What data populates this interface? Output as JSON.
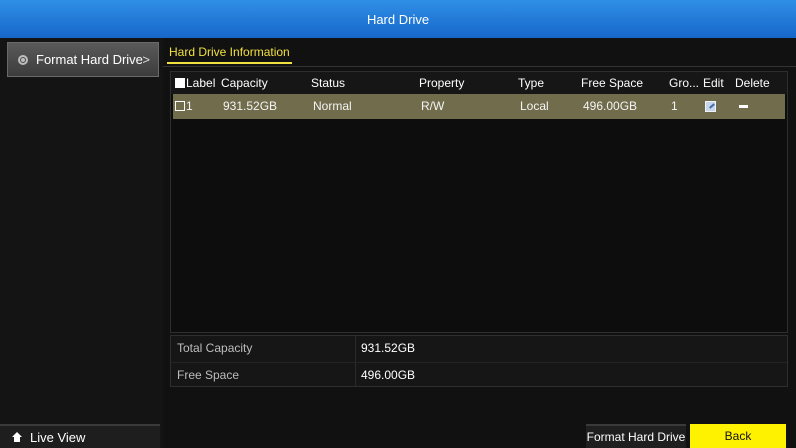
{
  "window": {
    "title": "Hard Drive"
  },
  "sidebar": {
    "items": [
      {
        "label": "Format Hard Drive",
        "icon": "gear-icon",
        "arrow": ">"
      }
    ],
    "live_view": {
      "label": "Live View",
      "icon": "home-icon"
    }
  },
  "main": {
    "tab": "Hard Drive Information",
    "table": {
      "headers": [
        "Label",
        "Capacity",
        "Status",
        "Property",
        "Type",
        "Free Space",
        "Gro...",
        "Edit",
        "Delete"
      ],
      "rows": [
        {
          "label": "1",
          "capacity": "931.52GB",
          "status": "Normal",
          "property": "R/W",
          "type": "Local",
          "free_space": "496.00GB",
          "group": "1",
          "edit_icon": "edit-icon",
          "delete_icon": "delete-icon"
        }
      ]
    },
    "summary": {
      "total_capacity_label": "Total Capacity",
      "total_capacity_value": "931.52GB",
      "free_space_label": "Free Space",
      "free_space_value": "496.00GB"
    }
  },
  "buttons": {
    "format": "Format Hard Drive",
    "back": "Back"
  },
  "colors": {
    "title_bar": "#1f7ad8",
    "accent_yellow": "#fff200",
    "selected_row": "#706c4c"
  }
}
